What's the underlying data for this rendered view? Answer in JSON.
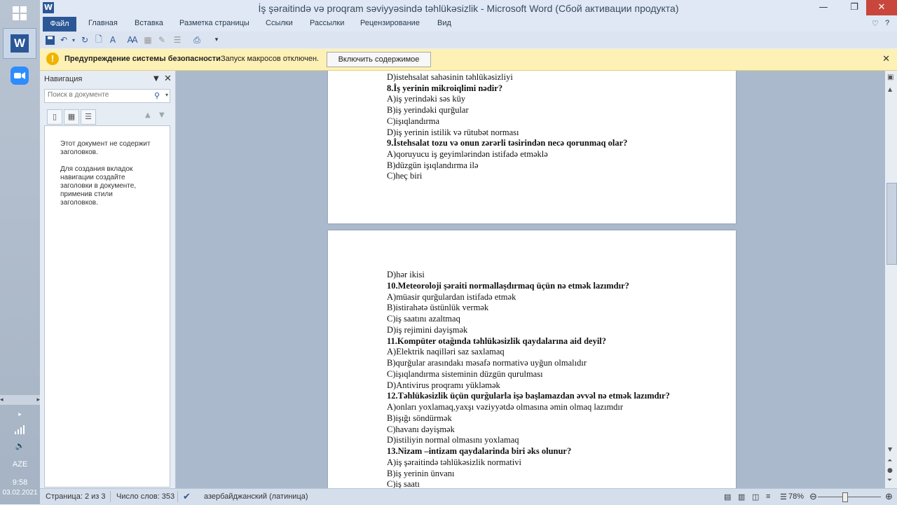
{
  "window": {
    "title": "İş şəraitində və proqram səviyyəsində təhlükəsizlik - Microsoft Word (Сбой активации продукта)",
    "app_letter": "W"
  },
  "ribbon": {
    "tabs": [
      "Файл",
      "Главная",
      "Вставка",
      "Разметка страницы",
      "Ссылки",
      "Рассылки",
      "Рецензирование",
      "Вид"
    ]
  },
  "security_bar": {
    "title": "Предупреждение системы безопасности",
    "message": "Запуск макросов отключен.",
    "button": "Включить содержимое"
  },
  "navigation": {
    "title": "Навигация",
    "search_placeholder": "Поиск в документе",
    "message1": "Этот документ не содержит заголовков.",
    "message2": "Для создания вкладок навигации создайте заголовки в документе, применив стили заголовков."
  },
  "document": {
    "page1_lines": [
      {
        "text": "D)istehsalat sahəsinin təhlükəsizliyi",
        "bold": false
      },
      {
        "text": "8.İş yerinin mikroiqlimi nədir?",
        "bold": true
      },
      {
        "text": "A)iş yerindəki səs küy",
        "bold": false
      },
      {
        "text": "B)iş yerindəki qurğular",
        "bold": false
      },
      {
        "text": "C)işıqlandırma",
        "bold": false
      },
      {
        "text": "D)iş yerinin istilik və rütubət norması",
        "bold": false
      },
      {
        "text": "9.İstehsalat tozu və onun zərərli təsirindən necə qorunmaq olar?",
        "bold": true
      },
      {
        "text": "A)qoruyucu iş geyimlərindən istifadə etməklə",
        "bold": false
      },
      {
        "text": "B)düzgün işıqlandırma ilə",
        "bold": false
      },
      {
        "text": "C)heç biri",
        "bold": false
      }
    ],
    "page2_lines": [
      {
        "text": "D)hər ikisi",
        "bold": false
      },
      {
        "text": "10.Meteoroloji şəraiti normallaşdırmaq üçün nə etmək lazımdır?",
        "bold": true
      },
      {
        "text": "A)müasir qurğulardan istifadə etmək",
        "bold": false
      },
      {
        "text": "B)istirahətə üstünlük vermək",
        "bold": false
      },
      {
        "text": "C)iş saatını azaltmaq",
        "bold": false
      },
      {
        "text": "D)iş rejimini dəyişmək",
        "bold": false
      },
      {
        "text": "11.Kompüter otağında təhlükəsizlik qaydalarına aid deyil?",
        "bold": true
      },
      {
        "text": "A)Elektrik naqilləri saz saxlamaq",
        "bold": false
      },
      {
        "text": "B)qurğular arasındakı məsafə  normativə uyğun olmalıdır",
        "bold": false
      },
      {
        "text": "C)işıqlandırma sisteminin düzgün qurulması",
        "bold": false
      },
      {
        "text": "D)Antivirus proqramı yükləmək",
        "bold": false
      },
      {
        "text": "12.Təhlükəsizlik üçün qurğularla işə başlamazdan əvvəl nə etmək lazımdır?",
        "bold": true
      },
      {
        "text": "A)onları yoxlamaq,yaxşı vəziyyətdə olmasına əmin olmaq lazımdır",
        "bold": false
      },
      {
        "text": "B)işığı söndürmək",
        "bold": false
      },
      {
        "text": "C)havanı dəyişmək",
        "bold": false
      },
      {
        "text": "D)istiliyin normal olmasını yoxlamaq",
        "bold": false
      },
      {
        "text": "13.Nizam –intizam qaydalarinda biri əks olunur?",
        "bold": true
      },
      {
        "text": "A)iş şəraitində təhlükəsizlik normativi",
        "bold": false
      },
      {
        "text": "B)iş yerinin ünvanı",
        "bold": false
      },
      {
        "text": "C)iş saatı",
        "bold": false
      }
    ]
  },
  "status": {
    "page": "Страница: 2 из 3",
    "words": "Число слов: 353",
    "language": "азербайджанский (латиница)",
    "zoom": "78%"
  },
  "taskbar": {
    "lang": "AZE",
    "time": "9:58",
    "date": "03.02.2021"
  },
  "colors": {
    "accent": "#2b5797",
    "security_bar": "#fdf1b5",
    "close_red": "#c9463d"
  }
}
